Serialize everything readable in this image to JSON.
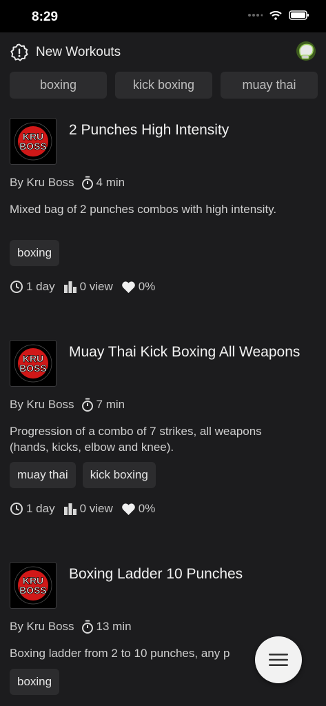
{
  "status": {
    "time": "8:29"
  },
  "header": {
    "title": "New Workouts"
  },
  "filters": [
    "boxing",
    "kick boxing",
    "muay thai"
  ],
  "workouts": [
    {
      "title": "2 Punches High Intensity",
      "author": "By Kru Boss",
      "duration": "4 min",
      "description": "Mixed bag of 2 punches combos with high intensity.",
      "tags": [
        "boxing"
      ],
      "age": "1 day",
      "views": "0 view",
      "likes": "0%"
    },
    {
      "title": "Muay Thai Kick Boxing All Weapons",
      "author": "By Kru Boss",
      "duration": "7 min",
      "description": "Progression of a combo of 7 strikes, all weapons (hands, kicks, elbow and knee).",
      "tags": [
        "muay thai",
        "kick boxing"
      ],
      "age": "1 day",
      "views": "0 view",
      "likes": "0%"
    },
    {
      "title": "Boxing Ladder 10 Punches",
      "author": "By Kru Boss",
      "duration": "13 min",
      "description": "Boxing ladder from 2 to 10 punches, any p",
      "tags": [
        "boxing"
      ]
    }
  ],
  "logo": {
    "text_top": "KRU",
    "text_bottom": "BOSS",
    "ring_text": "MIXED MARTIAL ARTS · PRODUCTS AND APPAREL"
  },
  "colors": {
    "background": "#1c1c1e",
    "chip": "#2c2c2e",
    "accent_red": "#d01818",
    "glove_green": "#7ed321"
  }
}
